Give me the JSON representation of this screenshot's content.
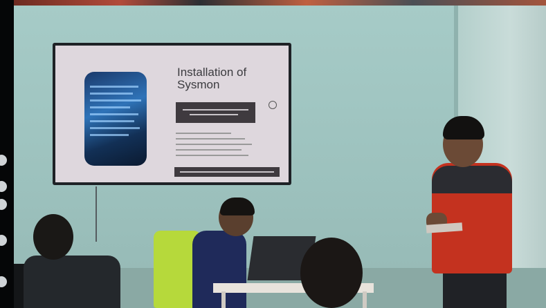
{
  "slide": {
    "title": "Installation of Sysmon"
  }
}
